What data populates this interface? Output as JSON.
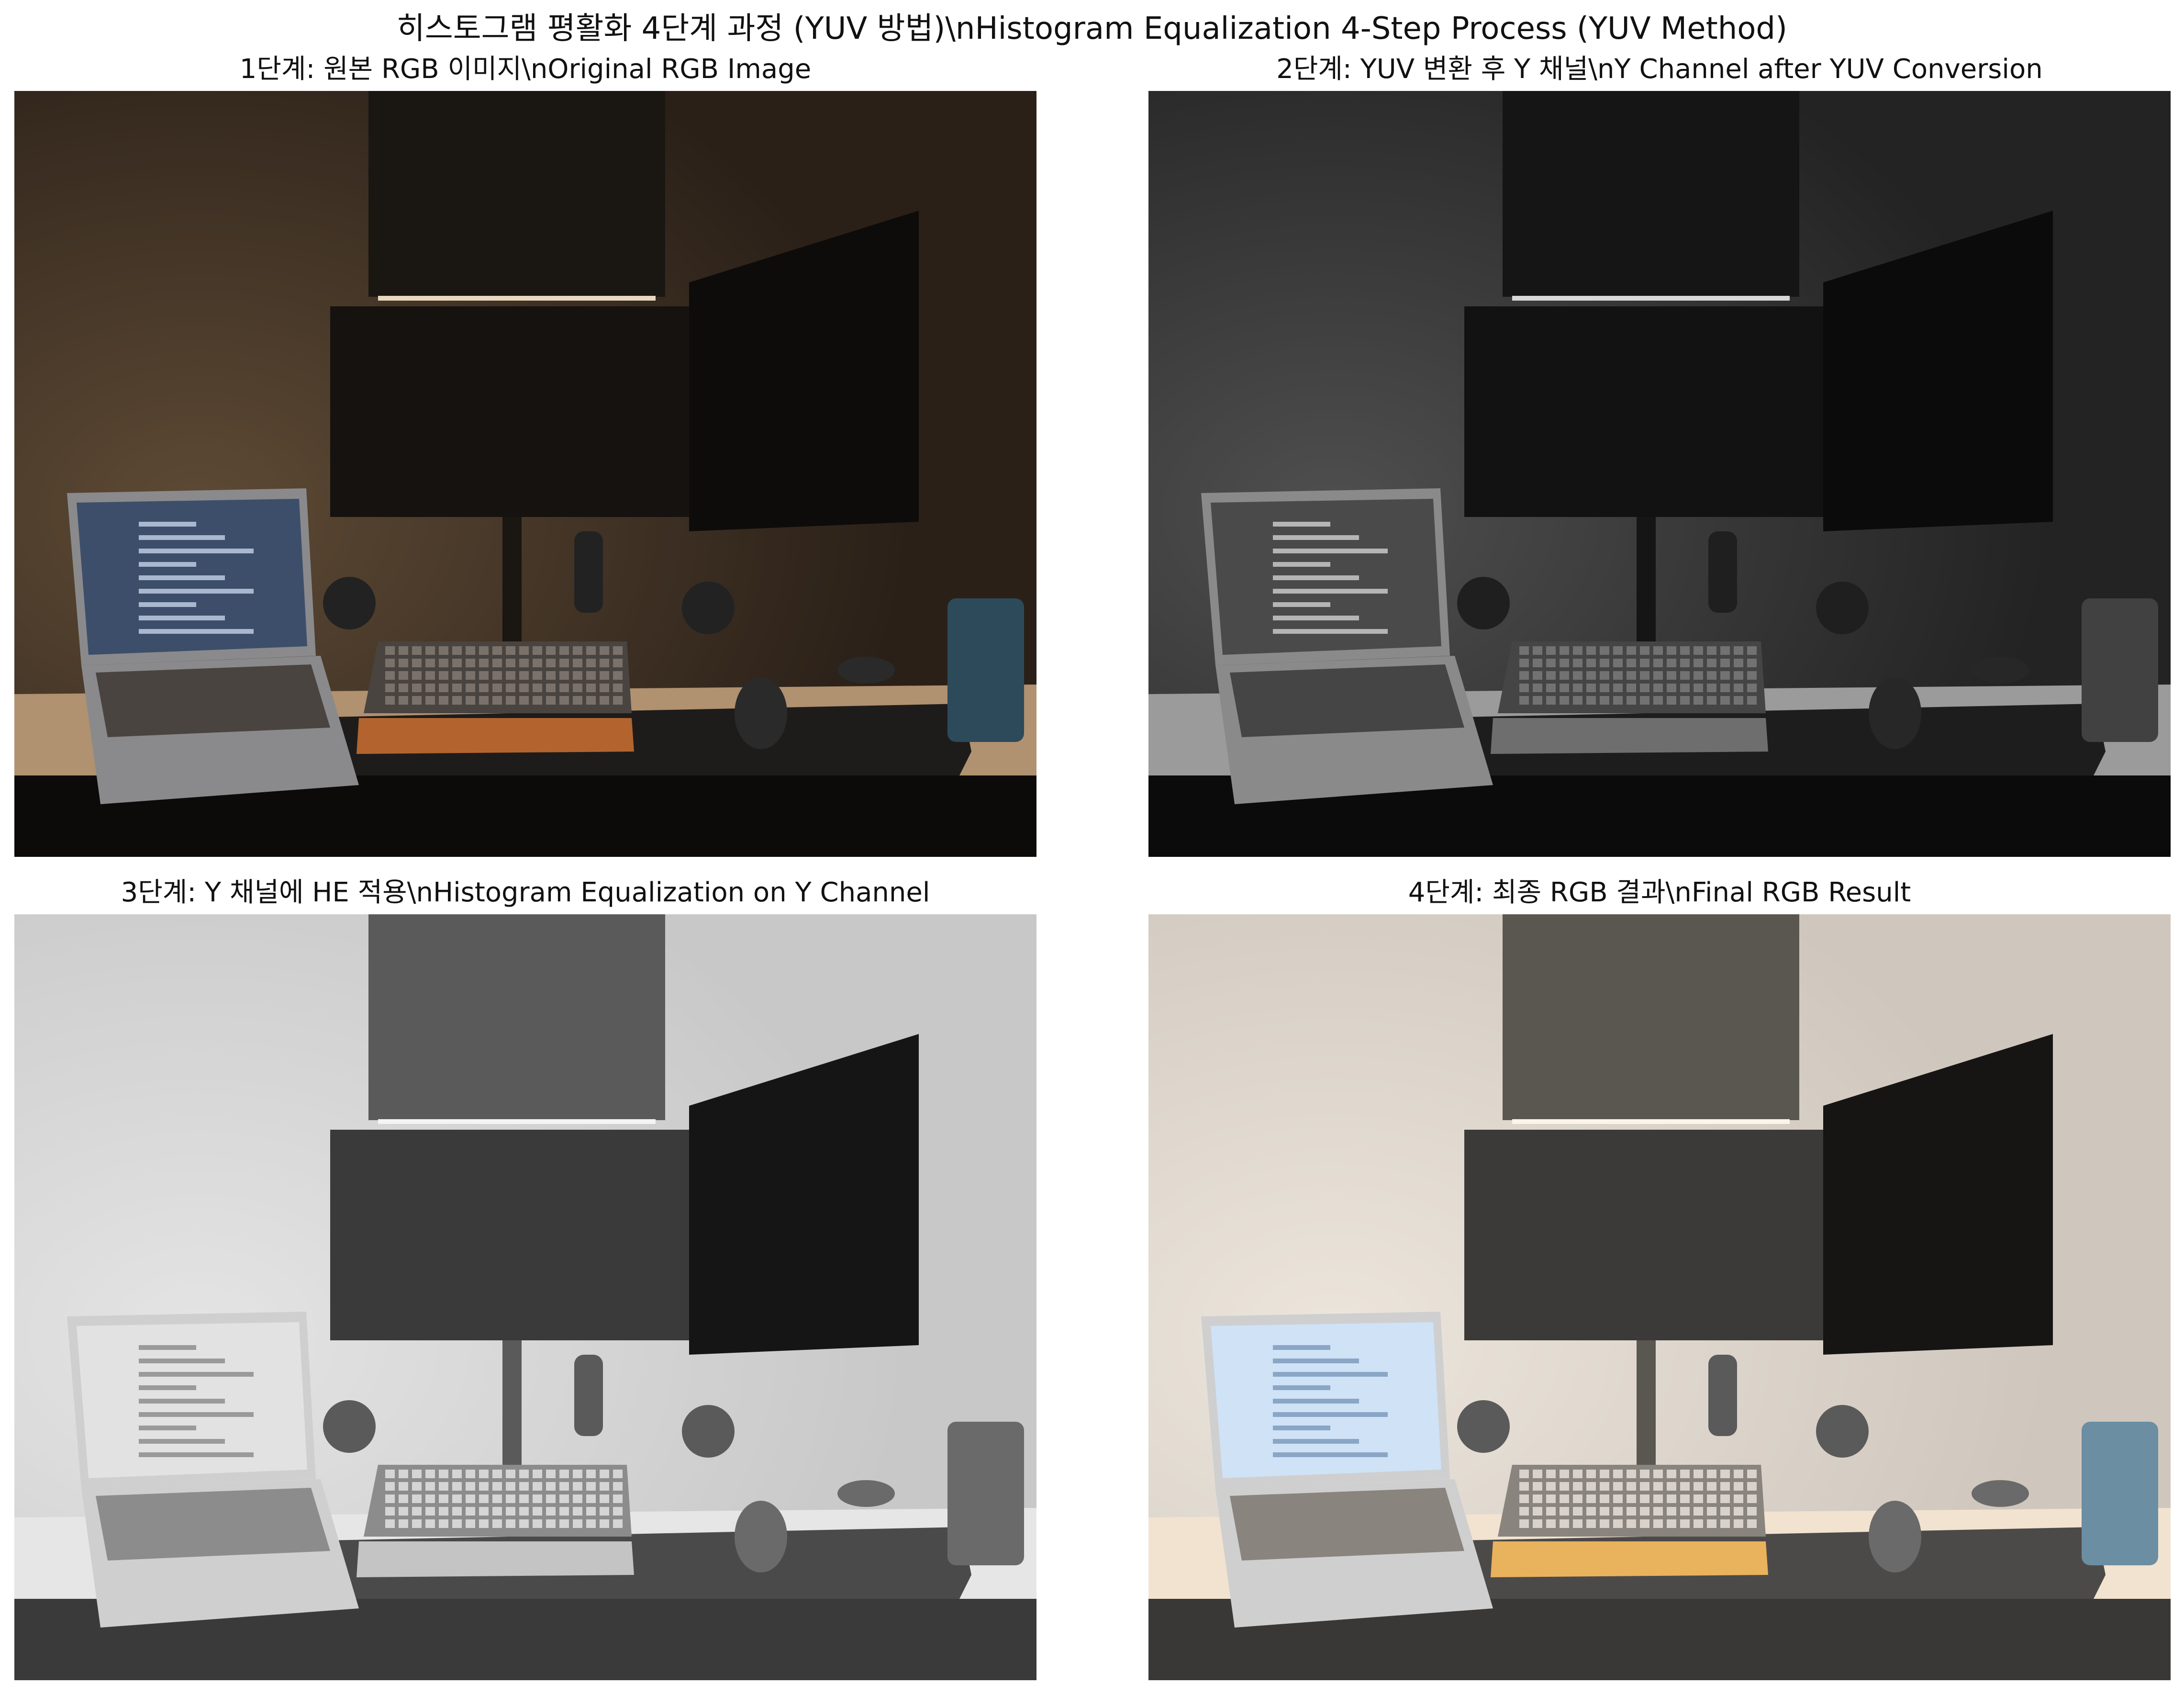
{
  "figure": {
    "title": "히스토그램 평활화 4단계 과정 (YUV 방법)\\nHistogram Equalization 4-Step Process (YUV Method)"
  },
  "panels": [
    {
      "title": "1단계: 원본 RGB 이미지\\nOriginal RGB Image",
      "palette": {
        "wall": "#2a2018",
        "wallLit": "#5e4a35",
        "shelf": "#1a1612",
        "monitor": "#15120f",
        "monitor2": "#0e0c0a",
        "desk": "#b09170",
        "deskShadow": "#3a2d22",
        "mat": "#1e1c1b",
        "laptopBody": "#8a8a8c",
        "laptopScreen": "#3c4e6a",
        "laptopText": "#a9b8cf",
        "keyboard": "#4a4440",
        "keys": "#7a726a",
        "wrist": "#b3642e",
        "cup": "#2d4a5a",
        "speaker": "#222222",
        "mouse": "#2a2a2a",
        "bottom": "#0d0b0a",
        "lightBar": "#e8d8c0"
      }
    },
    {
      "title": "2단계: YUV 변환 후 Y 채널\\nY Channel after YUV Conversion",
      "palette": {
        "wall": "#232323",
        "wallLit": "#4f4f4f",
        "shelf": "#151515",
        "monitor": "#121212",
        "monitor2": "#0b0b0b",
        "desk": "#9b9b9b",
        "deskShadow": "#303030",
        "mat": "#1d1d1d",
        "laptopBody": "#8a8a8a",
        "laptopScreen": "#4a4a4a",
        "laptopText": "#b5b5b5",
        "keyboard": "#454545",
        "keys": "#727272",
        "wrist": "#6e6e6e",
        "cup": "#414141",
        "speaker": "#1f1f1f",
        "mouse": "#272727",
        "bottom": "#0b0b0b",
        "lightBar": "#d8d8d8"
      }
    },
    {
      "title": "3단계: Y 채널에 HE 적용\\nHistogram Equalization on Y Channel",
      "palette": {
        "wall": "#c8c8c8",
        "wallLit": "#e4e4e4",
        "shelf": "#5a5a5a",
        "monitor": "#3a3a3a",
        "monitor2": "#151515",
        "desk": "#e6e6e6",
        "deskShadow": "#9a9a9a",
        "mat": "#4a4a4a",
        "laptopBody": "#cfcfcf",
        "laptopScreen": "#e2e2e2",
        "laptopText": "#9a9a9a",
        "keyboard": "#8c8c8c",
        "keys": "#d5d5d5",
        "wrist": "#c4c4c4",
        "cup": "#6a6a6a",
        "speaker": "#5a5a5a",
        "mouse": "#6a6a6a",
        "bottom": "#3a3a3a",
        "lightBar": "#f4f4f4"
      }
    },
    {
      "title": "4단계: 최종 RGB 결과\\nFinal RGB Result",
      "palette": {
        "wall": "#cfc7bd",
        "wallLit": "#ece5dc",
        "shelf": "#5a5650",
        "monitor": "#3c3a38",
        "monitor2": "#161514",
        "desk": "#f1e3cf",
        "deskShadow": "#a8998a",
        "mat": "#4c4a48",
        "laptopBody": "#cfcfd0",
        "laptopScreen": "#cfe2f6",
        "laptopText": "#8aa6c6",
        "keyboard": "#8a847e",
        "keys": "#d8d2cb",
        "wrist": "#e9b25c",
        "cup": "#6b8ea2",
        "speaker": "#5a5a5a",
        "mouse": "#6a6a6a",
        "bottom": "#3a3836",
        "lightBar": "#fbf4ea"
      }
    }
  ]
}
